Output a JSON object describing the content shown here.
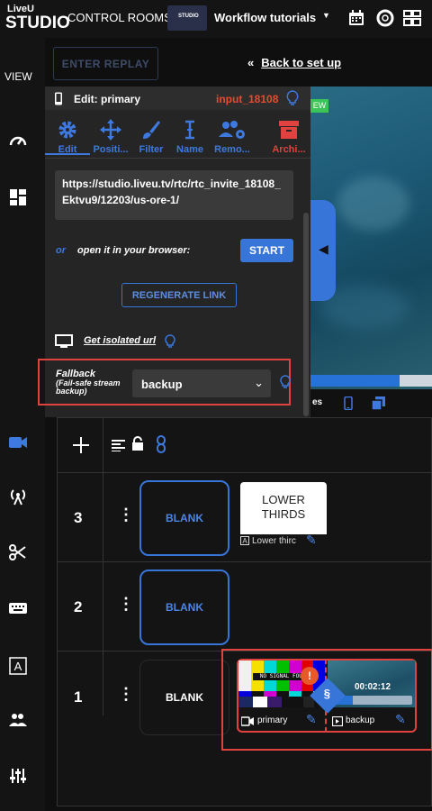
{
  "app": {
    "logo_top": "LiveU",
    "logo_bottom": "STUDIO",
    "control_rooms": "CONTROL ROOMS",
    "thumb_text": "STUDIO",
    "workspace": "Workflow tutorials"
  },
  "nav": {
    "view": "VIEW"
  },
  "toolbar": {
    "enter_replay": "ENTER REPLAY",
    "back_arrows": "«",
    "back_label": "Back to set up"
  },
  "panel": {
    "edit_title": "Edit: primary",
    "input_name": "input_18108",
    "tools": [
      {
        "label": "Edit"
      },
      {
        "label": "Positi..."
      },
      {
        "label": "Filter"
      },
      {
        "label": "Name"
      },
      {
        "label": "Remo..."
      },
      {
        "label": "Archi..."
      }
    ],
    "url": "https://studio.liveu.tv/rtc/rtc_invite_18108_Ektvu9/12203/us-ore-1/",
    "or": "or",
    "open_text": "open it in your browser:",
    "start": "START",
    "regenerate": "REGENERATE LINK",
    "isolated": "Get isolated url",
    "fallback_label": "Fallback",
    "fallback_sub": "(Fail-safe stream backup)",
    "fallback_value": "backup"
  },
  "preview": {
    "ew_tag": "EW",
    "bar_label": "es",
    "progress": 0.73
  },
  "layers": [
    {
      "num": "3",
      "blank": "BLANK",
      "lt_line1": "LOWER",
      "lt_line2": "THIRDS",
      "lt_name": "Lower thirc"
    },
    {
      "num": "2",
      "blank": "BLANK"
    },
    {
      "num": "1",
      "blank": "BLANK"
    }
  ],
  "sources": {
    "no_signal": "NO SIGNAL FOUND",
    "warning": "!",
    "backup_time": "00:02:12",
    "backup_progress": 0.27,
    "primary_label": "primary",
    "backup_label": "backup"
  },
  "colors": {
    "accent": "#3775d8",
    "alert": "#e0423f",
    "input_orange": "#e84a2f"
  }
}
